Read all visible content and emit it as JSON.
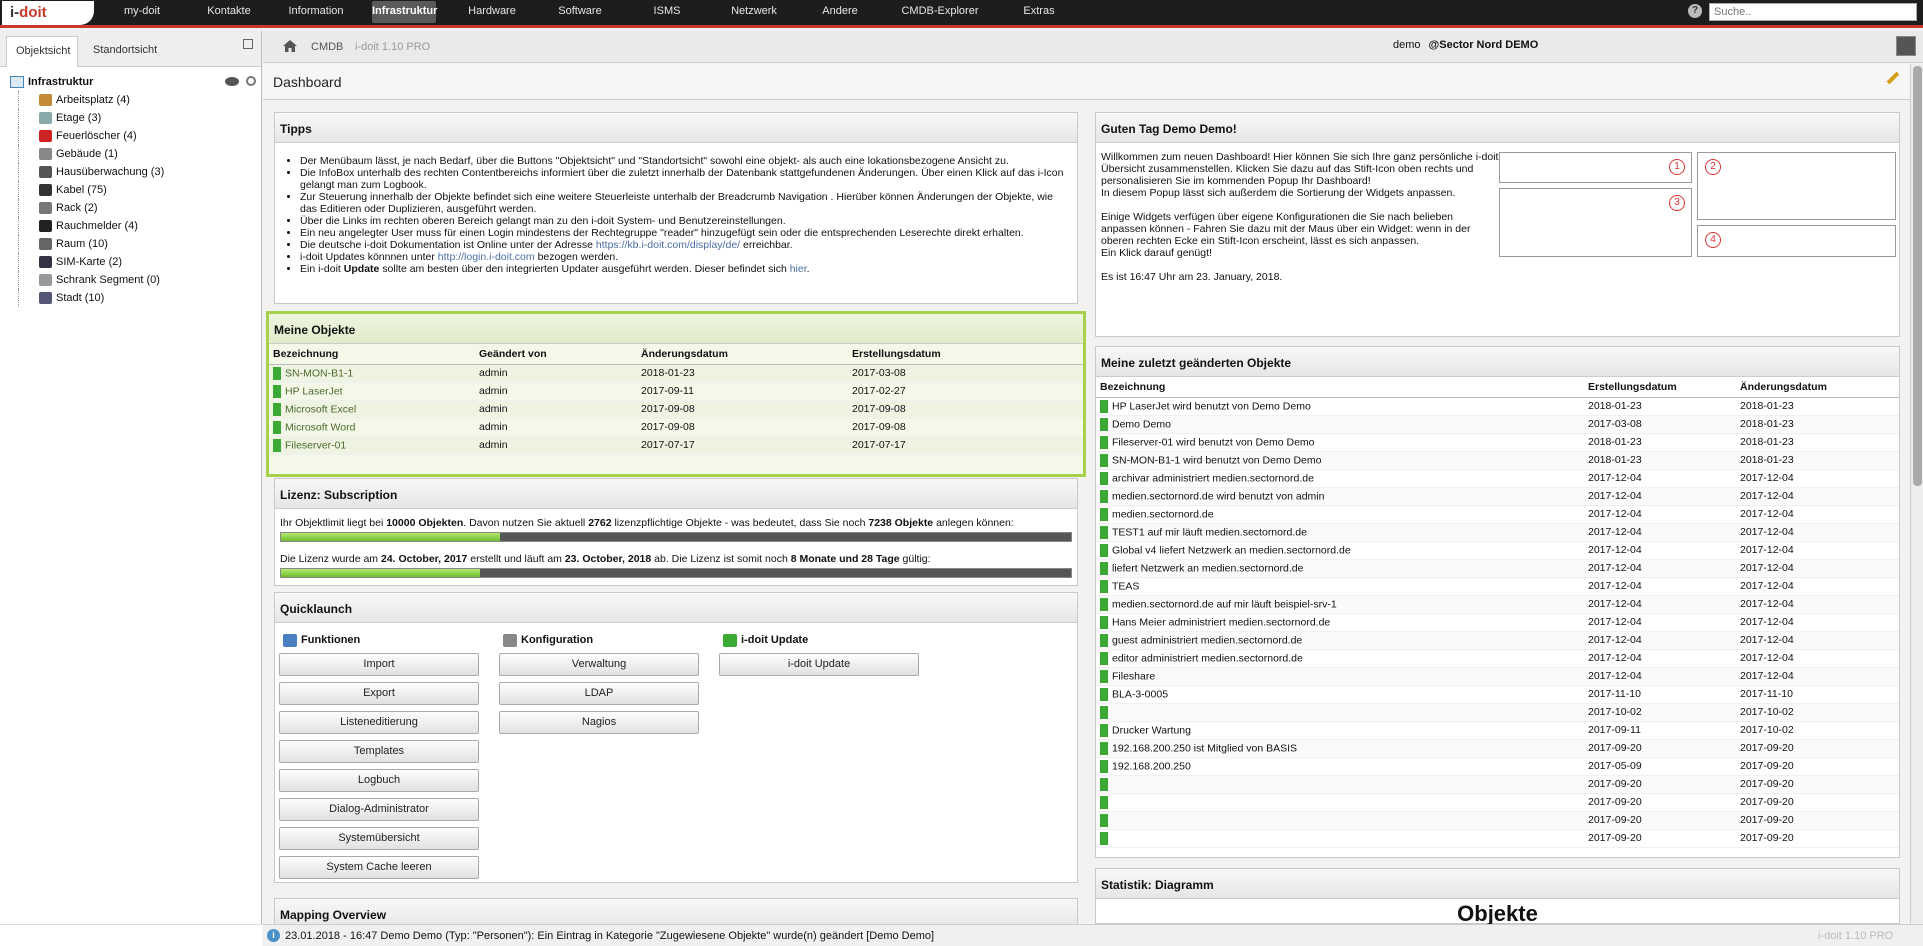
{
  "topbar": {
    "logo": {
      "prefix": "i-",
      "suffix": "doit"
    },
    "nav": [
      {
        "label": "my-doit",
        "active": false
      },
      {
        "label": "Kontakte",
        "active": false
      },
      {
        "label": "Information",
        "active": false
      },
      {
        "label": "Infrastruktur",
        "active": true
      },
      {
        "label": "Hardware",
        "active": false
      },
      {
        "label": "Software",
        "active": false
      },
      {
        "label": "ISMS",
        "active": false
      },
      {
        "label": "Netzwerk",
        "active": false
      },
      {
        "label": "Andere",
        "active": false
      },
      {
        "label": "CMDB-Explorer",
        "active": false
      },
      {
        "label": "Extras",
        "active": false
      }
    ],
    "help": "?",
    "search_placeholder": "Suche.."
  },
  "left": {
    "tabs": [
      "Objektsicht",
      "Standortsicht"
    ],
    "root": "Infrastruktur",
    "items": [
      "Arbeitsplatz (4)",
      "Etage (3)",
      "Feuerlöscher (4)",
      "Gebäude (1)",
      "Hausüberwachung (3)",
      "Kabel (75)",
      "Rack (2)",
      "Rauchmelder (4)",
      "Raum (10)",
      "SIM-Karte (2)",
      "Schrank Segment (0)",
      "Stadt (10)"
    ]
  },
  "breadcrumb": {
    "items": [
      "CMDB",
      "i-doit 1.10 PRO"
    ],
    "user": "demo",
    "tenant": "@Sector Nord DEMO"
  },
  "dashboard": {
    "title": "Dashboard"
  },
  "tips": {
    "title": "Tipps",
    "items": [
      "Der Menübaum lässt, je nach Bedarf, über die Buttons \"Objektsicht\" und \"Standortsicht\" sowohl eine objekt- als auch eine lokationsbezogene Ansicht zu.",
      "Die InfoBox unterhalb des rechten Contentbereichs informiert über die zuletzt innerhalb der Datenbank stattgefundenen Änderungen. Über einen Klick auf das i-Icon gelangt man zum Logbook.",
      "Zur Steuerung innerhalb der Objekte befindet sich eine weitere Steuerleiste unterhalb der Breadcrumb Navigation . Hierüber können Änderungen der Objekte, wie das Editieren oder Duplizieren, ausgeführt werden.",
      "Über die Links im rechten oberen Bereich gelangt man zu den i-doit System- und Benutzereinstellungen.",
      "Ein neu angelegter User muss für einen Login mindestens der Rechtegruppe \"reader\" hinzugefügt sein oder die entsprechenden Leserechte direkt erhalten."
    ],
    "doc_pre": "Die deutsche i-doit Dokumentation ist Online unter der Adresse ",
    "doc_link": "https://kb.i-doit.com/display/de/",
    "doc_post": " erreichbar.",
    "upd_pre": "i-doit Updates könnnen unter ",
    "upd_link": "http://login.i-doit.com",
    "upd_post": " bezogen werden.",
    "last_pre": "Ein i-doit ",
    "last_bold": "Update",
    "last_mid": " sollte am besten über den integrierten Updater ausgeführt werden. Dieser befindet sich ",
    "last_link": "hier",
    "last_post": "."
  },
  "meine": {
    "title": "Meine Objekte",
    "columns": [
      "Bezeichnung",
      "Geändert von",
      "Änderungsdatum",
      "Erstellungsdatum"
    ],
    "rows": [
      [
        "SN-MON-B1-1",
        "admin",
        "2018-01-23",
        "2017-03-08"
      ],
      [
        "HP LaserJet",
        "admin",
        "2017-09-11",
        "2017-02-27"
      ],
      [
        "Microsoft Excel",
        "admin",
        "2017-09-08",
        "2017-09-08"
      ],
      [
        "Microsoft Word",
        "admin",
        "2017-09-08",
        "2017-09-08"
      ],
      [
        "Fileserver-01",
        "admin",
        "2017-07-17",
        "2017-07-17"
      ]
    ]
  },
  "lizenz": {
    "title": "Lizenz: Subscription",
    "l1_a": "Ihr Objektlimit liegt bei ",
    "l1_b": "10000 Objekten",
    "l1_c": ". Davon nutzen Sie aktuell ",
    "l1_d": "2762",
    "l1_e": " lizenzpflichtige Objekte - was bedeutet, dass Sie noch ",
    "l1_f": "7238 Objekte",
    "l1_g": " anlegen können:",
    "usage_fraction": 0.2762,
    "l2_a": "Die Lizenz wurde am ",
    "l2_b": "24. October, 2017",
    "l2_c": " erstellt und läuft am ",
    "l2_d": "23. October, 2018",
    "l2_e": " ab. Die Lizenz ist somit noch ",
    "l2_f": "8 Monate und 28 Tage",
    "l2_g": " gültig:",
    "time_fraction": 0.25
  },
  "quick": {
    "title": "Quicklaunch",
    "columns": [
      {
        "title": "Funktionen",
        "icon": "functions-icon",
        "color": "#4a7fc1",
        "buttons": [
          "Import",
          "Export",
          "Listeneditierung",
          "Templates",
          "Logbuch",
          "Dialog-Administrator",
          "Systemübersicht",
          "System Cache leeren"
        ]
      },
      {
        "title": "Konfiguration",
        "icon": "gear-icon",
        "color": "#888888",
        "buttons": [
          "Verwaltung",
          "LDAP",
          "Nagios"
        ]
      },
      {
        "title": "i-doit Update",
        "icon": "update-icon",
        "color": "#3aaa35",
        "buttons": [
          "i-doit Update"
        ]
      }
    ]
  },
  "mapping": {
    "title": "Mapping Overview"
  },
  "guten": {
    "title": "Guten Tag Demo Demo!",
    "p1": "Willkommen zum neuen Dashboard! Hier können Sie sich Ihre ganz persönliche i-doit Übersicht zusammenstellen. Klicken Sie dazu auf das Stift-Icon oben rechts und personalisieren Sie im kommenden Popup Ihr Dashboard!",
    "p2": "In diesem Popup lässt sich außerdem die Sortierung der Widgets anpassen.",
    "p3": "Einige Widgets verfügen über eigene Konfigurationen die Sie nach belieben anpassen können - Fahren Sie dazu mit der Maus über ein Widget: wenn in der oberen rechten Ecke ein Stift-Icon erscheint, lässt es sich anpassen.",
    "p4": "Ein Klick darauf genügt!",
    "time": "Es ist 16:47 Uhr am 23. January, 2018.",
    "nums": [
      "1",
      "2",
      "3",
      "4"
    ]
  },
  "recent": {
    "title": "Meine zuletzt geänderten Objekte",
    "columns": [
      "Bezeichnung",
      "Erstellungsdatum",
      "Änderungsdatum"
    ],
    "rows": [
      [
        "HP LaserJet wird benutzt von Demo Demo",
        "2018-01-23",
        "2018-01-23"
      ],
      [
        "Demo Demo",
        "2017-03-08",
        "2018-01-23"
      ],
      [
        "Fileserver-01 wird benutzt von Demo Demo",
        "2018-01-23",
        "2018-01-23"
      ],
      [
        "SN-MON-B1-1 wird benutzt von Demo Demo",
        "2018-01-23",
        "2018-01-23"
      ],
      [
        "archivar administriert medien.sectornord.de",
        "2017-12-04",
        "2017-12-04"
      ],
      [
        "medien.sectornord.de wird benutzt von admin",
        "2017-12-04",
        "2017-12-04"
      ],
      [
        "medien.sectornord.de",
        "2017-12-04",
        "2017-12-04"
      ],
      [
        "TEST1 auf mir läuft medien.sectornord.de",
        "2017-12-04",
        "2017-12-04"
      ],
      [
        "Global v4 liefert Netzwerk an medien.sectornord.de",
        "2017-12-04",
        "2017-12-04"
      ],
      [
        "liefert Netzwerk an medien.sectornord.de",
        "2017-12-04",
        "2017-12-04"
      ],
      [
        "TEAS",
        "2017-12-04",
        "2017-12-04"
      ],
      [
        "medien.sectornord.de auf mir läuft beispiel-srv-1",
        "2017-12-04",
        "2017-12-04"
      ],
      [
        "Hans Meier administriert medien.sectornord.de",
        "2017-12-04",
        "2017-12-04"
      ],
      [
        "guest administriert medien.sectornord.de",
        "2017-12-04",
        "2017-12-04"
      ],
      [
        "editor administriert medien.sectornord.de",
        "2017-12-04",
        "2017-12-04"
      ],
      [
        "Fileshare",
        "2017-12-04",
        "2017-12-04"
      ],
      [
        "BLA-3-0005",
        "2017-11-10",
        "2017-11-10"
      ],
      [
        "",
        "2017-10-02",
        "2017-10-02"
      ],
      [
        "Drucker Wartung",
        "2017-09-11",
        "2017-10-02"
      ],
      [
        "192.168.200.250 ist Mitglied von BASIS",
        "2017-09-20",
        "2017-09-20"
      ],
      [
        "192.168.200.250",
        "2017-05-09",
        "2017-09-20"
      ],
      [
        "",
        "2017-09-20",
        "2017-09-20"
      ],
      [
        "",
        "2017-09-20",
        "2017-09-20"
      ],
      [
        "",
        "2017-09-20",
        "2017-09-20"
      ],
      [
        "",
        "2017-09-20",
        "2017-09-20"
      ]
    ]
  },
  "statistik": {
    "title": "Statistik: Diagramm",
    "chart_title": "Objekte"
  },
  "status": {
    "text": "23.01.2018 - 16:47 Demo Demo (Typ: \"Personen\"): Ein Eintrag in Kategorie \"Zugewiesene Objekte\" wurde(n) geändert [Demo Demo]",
    "version": "i-doit 1.10 PRO"
  }
}
